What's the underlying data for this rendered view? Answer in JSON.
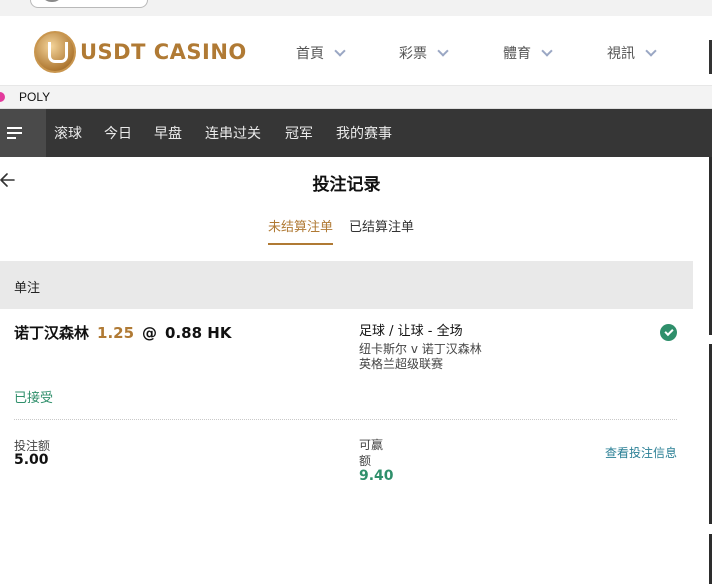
{
  "site": {
    "logo_text": "USDT CASINO",
    "nav": [
      "首頁",
      "彩票",
      "體育",
      "視訊"
    ]
  },
  "provider": {
    "label": "POLY"
  },
  "sport_nav": {
    "tabs": [
      "滚球",
      "今日",
      "早盘",
      "连串过关",
      "冠军",
      "我的赛事"
    ]
  },
  "page": {
    "title": "投注记录",
    "tabs": [
      {
        "label": "未结算注单",
        "active": true
      },
      {
        "label": "已结算注单",
        "active": false
      }
    ]
  },
  "section": {
    "label": "单注"
  },
  "bet": {
    "selection": "诺丁汉森林",
    "odds": "1.25",
    "at": "@",
    "price": "0.88 HK",
    "market": "足球 / 让球 - 全场",
    "match": "纽卡斯尔 v 诺丁汉森林",
    "league": "英格兰超级联赛",
    "status": "已接受",
    "stake_label": "投注额",
    "stake_value": "5.00",
    "win_label": "可赢额",
    "win_value": "9.40",
    "details_link": "查看投注信息"
  },
  "colors": {
    "accent_gold": "#b07a34",
    "success_green": "#2f8f6b",
    "link_teal": "#2a7f95",
    "nav_dark": "#363636"
  }
}
